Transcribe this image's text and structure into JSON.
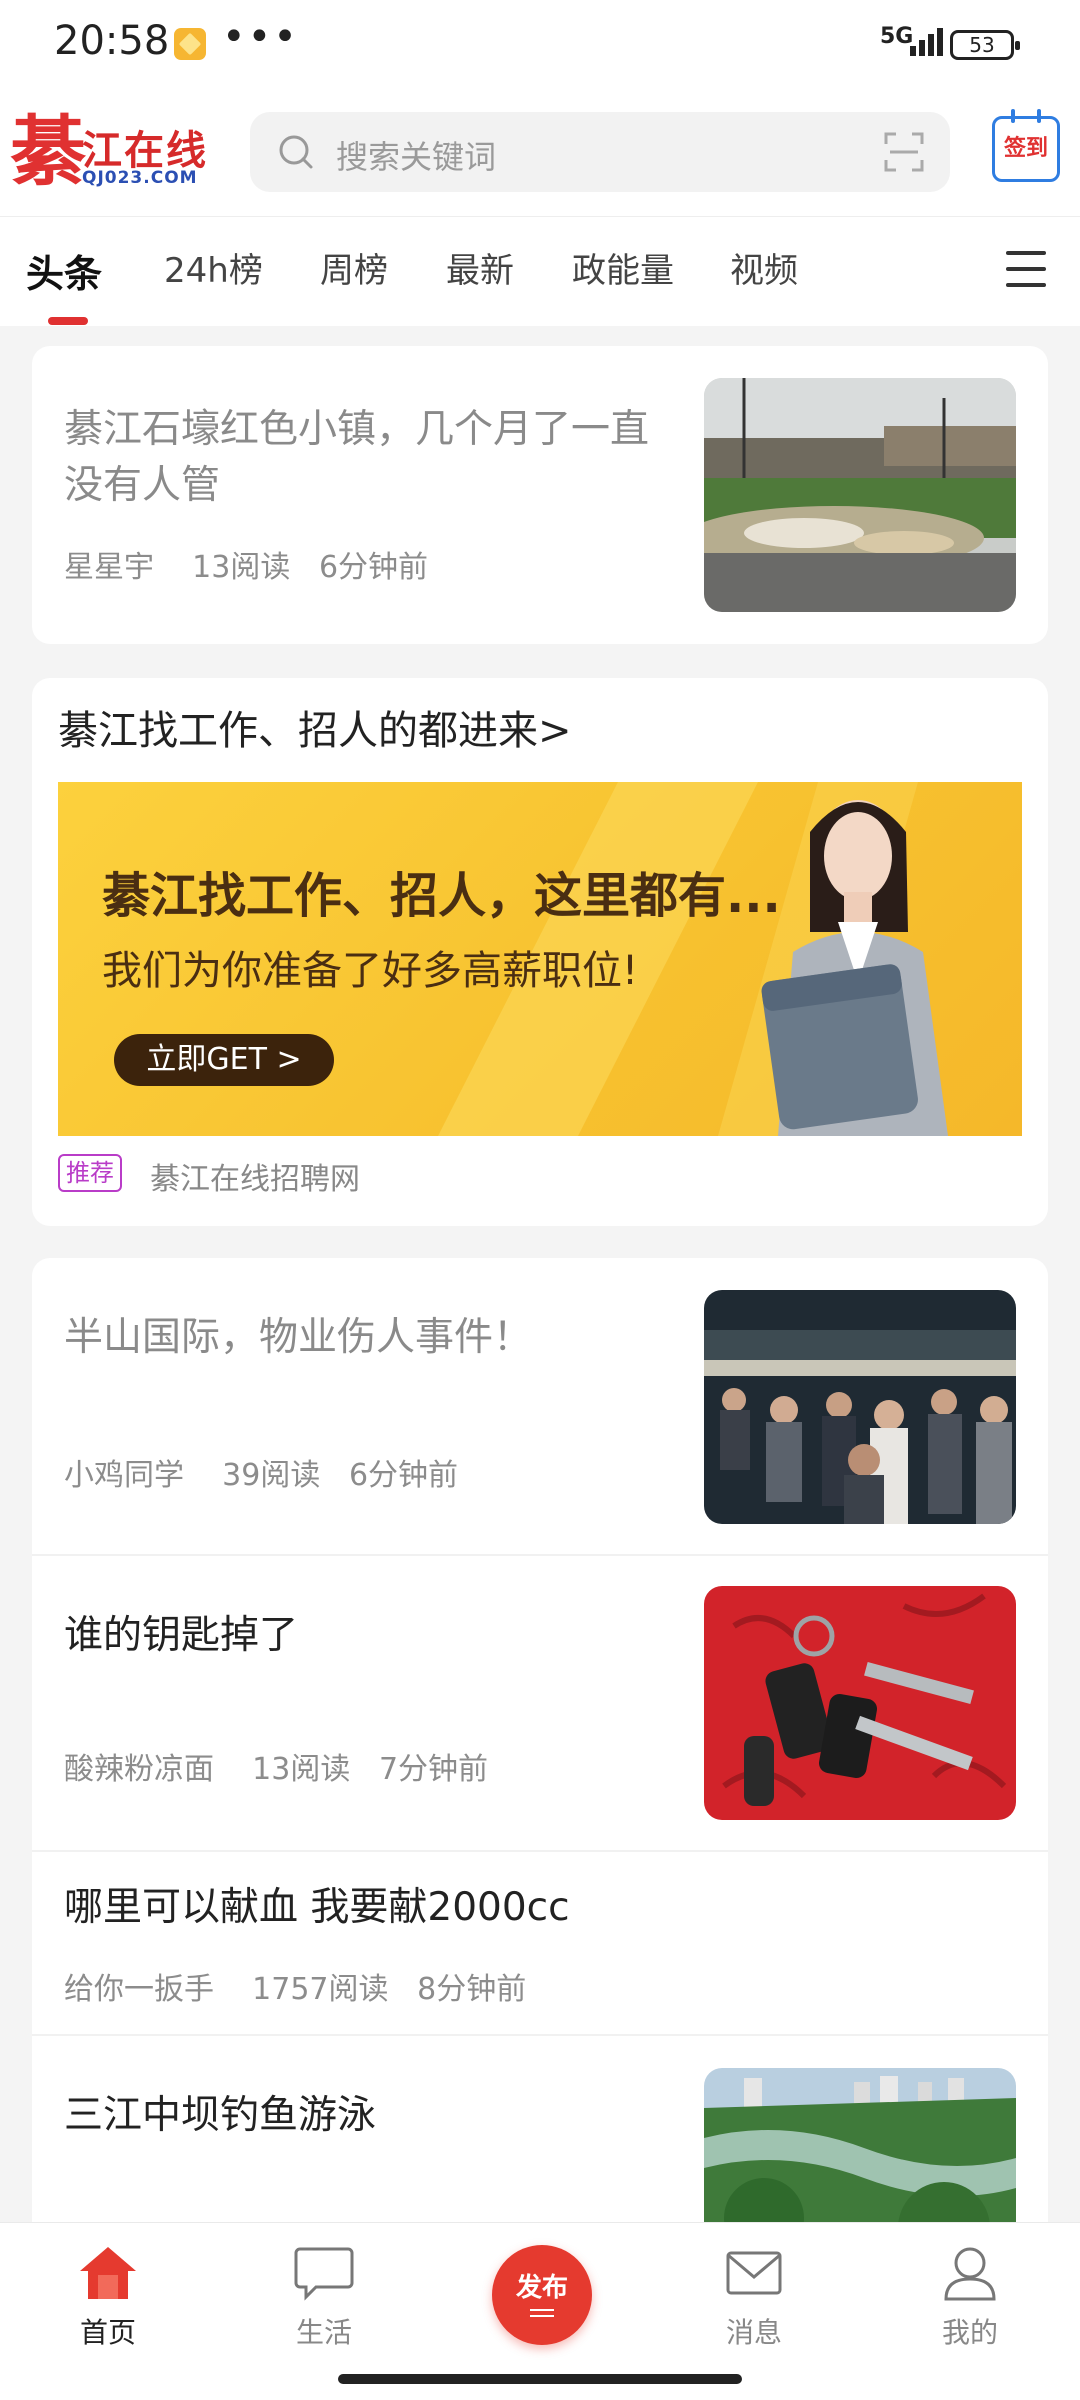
{
  "status": {
    "time": "20:58",
    "dots": "•••",
    "network": "5G",
    "battery": "53"
  },
  "header": {
    "logo_char": "綦",
    "logo_text": "江在线",
    "logo_sub": "QJ023.COM",
    "search_placeholder": "搜索关键词",
    "signin_label": "签到"
  },
  "tabs": [
    {
      "label": "头条"
    },
    {
      "label": "24h榜"
    },
    {
      "label": "周榜"
    },
    {
      "label": "最新"
    },
    {
      "label": "政能量"
    },
    {
      "label": "视频"
    }
  ],
  "feed": {
    "item1": {
      "title": "綦江石壕红色小镇，几个月了一直没有人管",
      "author": "星星宇",
      "reads": "13阅读",
      "time": "6分钟前"
    },
    "job": {
      "link": "綦江找工作、招人的都进来>",
      "banner_line1": "綦江找工作、招人，这里都有...",
      "banner_line2": "我们为你准备了好多高薪职位!",
      "banner_button": "立即GET >",
      "badge": "推荐",
      "source": "綦江在线招聘网"
    },
    "item2": {
      "title": "半山国际，物业伤人事件！",
      "author": "小鸡同学",
      "reads": "39阅读",
      "time": "6分钟前"
    },
    "item3": {
      "title": "谁的钥匙掉了",
      "author": "酸辣粉凉面",
      "reads": "13阅读",
      "time": "7分钟前"
    },
    "item4": {
      "title": "哪里可以献血 我要献2000cc",
      "author": "给你一扳手",
      "reads": "1757阅读",
      "time": "8分钟前"
    },
    "item5": {
      "title": "三江中坝钓鱼游泳"
    }
  },
  "nav": {
    "home": "首页",
    "life": "生活",
    "publish": "发布",
    "messages": "消息",
    "mine": "我的"
  },
  "colors": {
    "accent": "#e03131",
    "publish": "#e53a2f",
    "badge": "#b93cc8"
  }
}
